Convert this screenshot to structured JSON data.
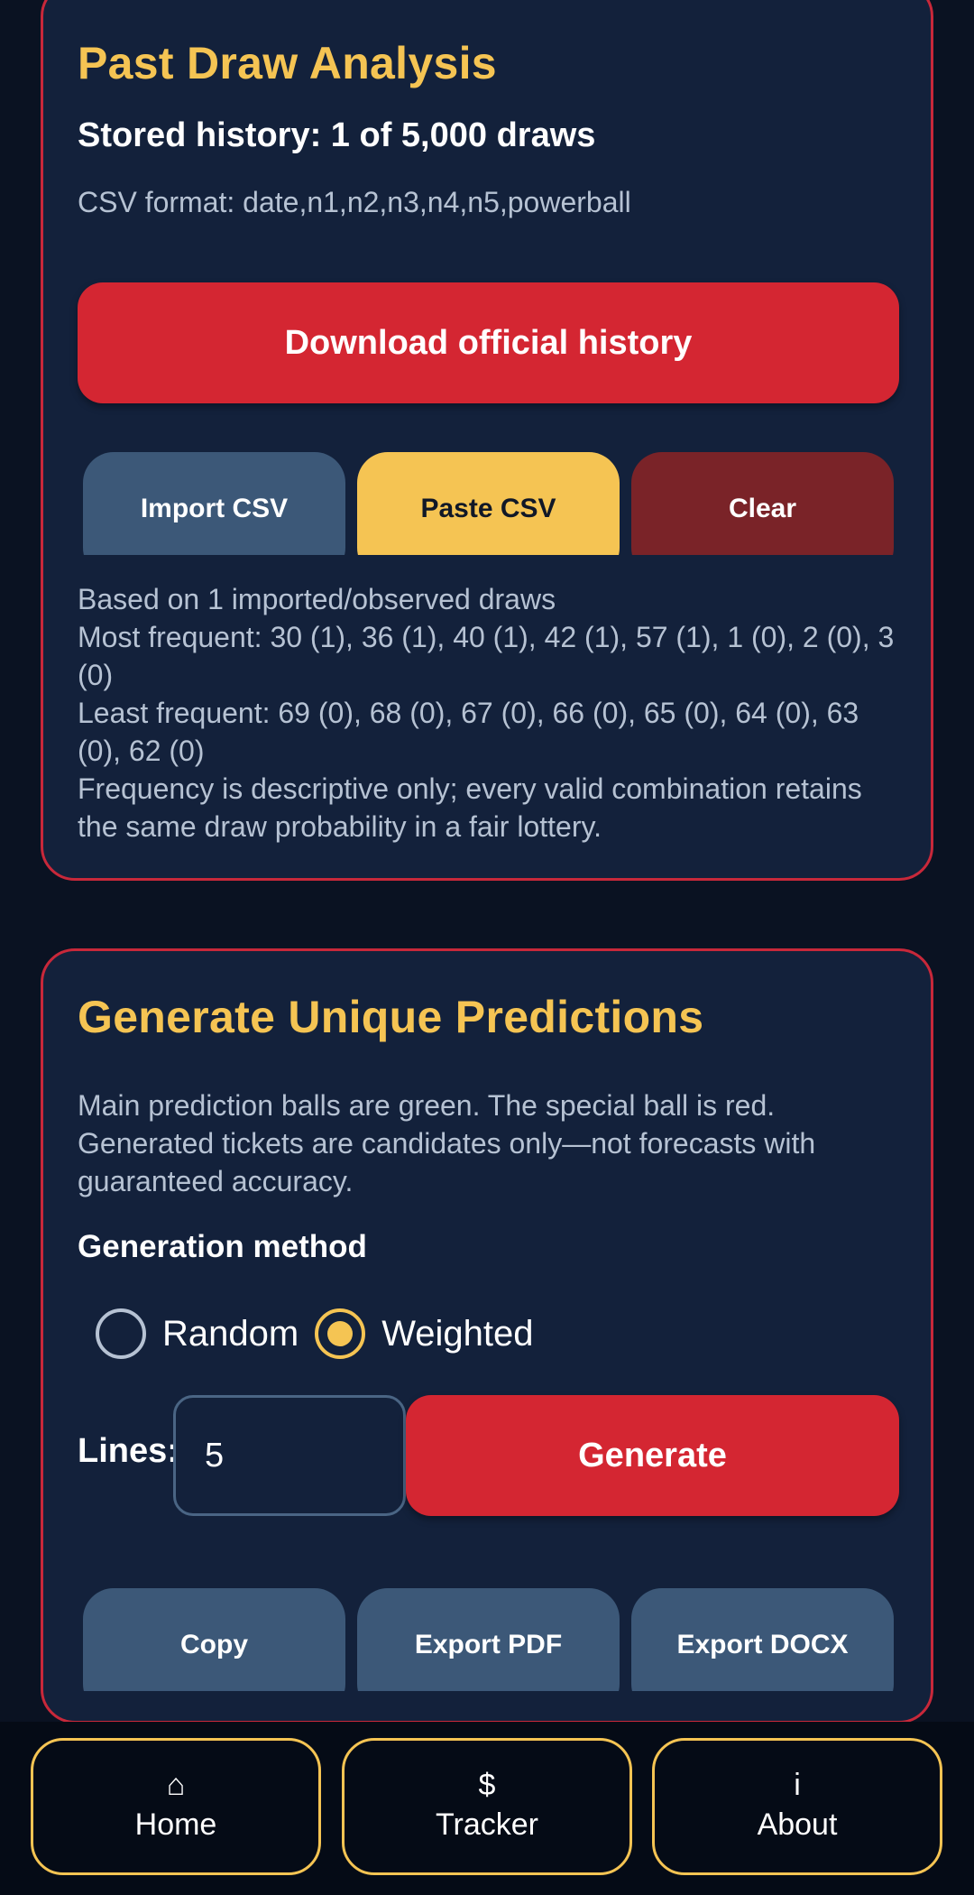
{
  "history": {
    "title": "Past Draw Analysis",
    "stored": "Stored history: 1 of 5,000 draws",
    "format": "CSV format: date,n1,n2,n3,n4,n5,powerball",
    "download_label": "Download official history",
    "buttons": {
      "import": "Import CSV",
      "paste": "Paste CSV",
      "clear": "Clear"
    },
    "stats": {
      "based_on": "Based on 1 imported/observed draws",
      "most_frequent": "Most frequent: 30 (1), 36 (1), 40 (1), 42 (1), 57 (1), 1 (0), 2 (0), 3 (0)",
      "least_frequent": "Least frequent: 69 (0), 68 (0), 67 (0), 66 (0), 65 (0), 64 (0), 63 (0), 62 (0)",
      "note": "Frequency is descriptive only; every valid combination retains the same draw probability in a fair lottery."
    }
  },
  "generate": {
    "title": "Generate Unique Predictions",
    "description": "Main prediction balls are green. The special ball is red. Generated tickets are candidates only—not forecasts with guaranteed accuracy.",
    "method_label": "Generation method",
    "methods": {
      "random": "Random",
      "weighted": "Weighted",
      "selected": "weighted"
    },
    "lines_label": "Lines:",
    "lines_value": "5",
    "generate_label": "Generate",
    "actions": {
      "copy": "Copy",
      "export_pdf": "Export PDF",
      "export_docx": "Export DOCX"
    }
  },
  "nav": {
    "home": {
      "icon": "⌂",
      "icon_name": "home-icon",
      "label": "Home"
    },
    "tracker": {
      "icon": "$",
      "icon_name": "dollar-icon",
      "label": "Tracker"
    },
    "about": {
      "icon": "i",
      "icon_name": "info-icon",
      "label": "About"
    }
  },
  "colors": {
    "background": "#0a1222",
    "card": "#13213b",
    "card_border": "#c8283a",
    "accent_yellow": "#f5c453",
    "primary_red": "#d42632",
    "slate_button": "#3c5878",
    "maroon_button": "#7a2328"
  }
}
